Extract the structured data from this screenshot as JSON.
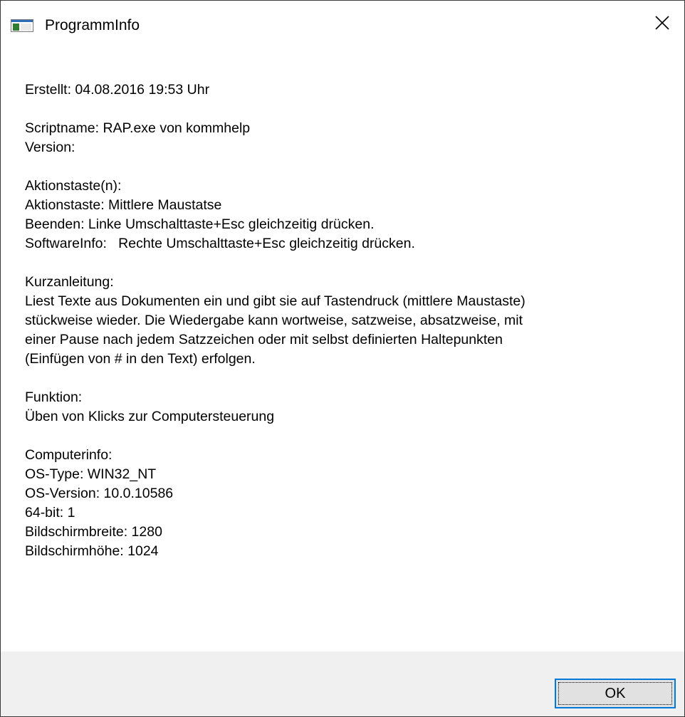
{
  "window": {
    "title": "ProgrammInfo",
    "icon": "application-icon",
    "close_icon": "close-icon"
  },
  "info": {
    "created": "Erstellt: 04.08.2016 19:53 Uhr",
    "scriptname": "Scriptname: RAP.exe von kommhelp",
    "version": "Version:",
    "keys_heading": "Aktionstaste(n):",
    "key_action": "Aktionstaste: Mittlere Maustatse",
    "key_quit": "Beenden: Linke Umschalttaste+Esc gleichzeitig drücken.",
    "key_softwareinfo": "SoftwareInfo:   Rechte Umschalttaste+Esc gleichzeitig drücken.",
    "guide_heading": "Kurzanleitung:",
    "guide_lines": [
      "Liest Texte aus Dokumenten ein und gibt sie auf Tastendruck (mittlere Maustaste)",
      "stückweise wieder. Die Wiedergabe kann wortweise, satzweise, absatzweise, mit",
      "einer Pause nach jedem Satzzeichen oder mit selbst definierten Haltepunkten",
      "(Einfügen von # in den Text) erfolgen."
    ],
    "function_heading": "Funktion:",
    "function_text": "Üben von Klicks zur Computersteuerung",
    "computer_heading": "Computerinfo:",
    "os_type": "OS-Type: WIN32_NT",
    "os_version": "OS-Version: 10.0.10586",
    "bits": "64-bit: 1",
    "screen_width": "Bildschirmbreite: 1280",
    "screen_height": "Bildschirmhöhe: 1024"
  },
  "footer": {
    "ok_label": "OK"
  },
  "colors": {
    "footer_background": "#f0f0f0",
    "button_focus_border": "#0078d7",
    "button_face": "#e1e1e1"
  }
}
